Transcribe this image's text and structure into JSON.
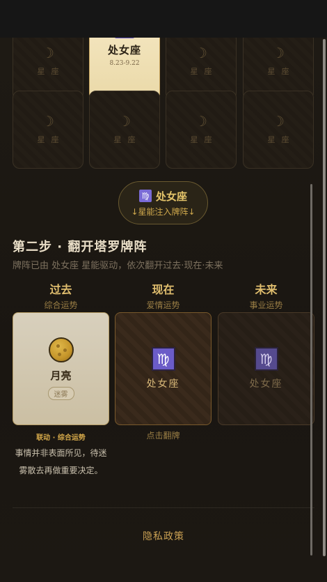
{
  "zodiac_grid": {
    "cells": [
      {
        "symbol": "☽",
        "label": "星座"
      },
      {
        "symbol": "♍",
        "label": "处女座",
        "date": "8.23-9.22",
        "selected": true
      },
      {
        "symbol": "☽",
        "label": "星座"
      },
      {
        "symbol": "☽",
        "label": "星座"
      },
      {
        "symbol": "☽",
        "label": "星座"
      },
      {
        "symbol": "☽",
        "label": "星座"
      },
      {
        "symbol": "☽",
        "label": "星座"
      },
      {
        "symbol": "☽",
        "label": "星座"
      }
    ]
  },
  "energy_pill": {
    "symbol": "♍",
    "name": "处女座",
    "subtitle": "↓星能注入牌阵↓"
  },
  "step": {
    "title": "第二步 · 翻开塔罗牌阵",
    "description": "牌阵已由 处女座 星能驱动，依次翻开过去·现在·未来"
  },
  "spread": {
    "past": {
      "heading": "过去",
      "sub": "综合运势",
      "card_name": "月亮",
      "card_tag": "迷雾",
      "linked": "联动 · 综合运势",
      "explanation": "事情并非表面所见，待迷雾散去再做重要决定。"
    },
    "present": {
      "heading": "现在",
      "sub": "爱情运势",
      "card_symbol": "♍",
      "card_name": "处女座",
      "hint": "点击翻牌"
    },
    "future": {
      "heading": "未来",
      "sub": "事业运势",
      "card_symbol": "♍",
      "card_name": "处女座"
    }
  },
  "footer": {
    "privacy": "隐私政策"
  },
  "colors": {
    "gold": "#e0be6e",
    "accent_purple": "#6b5cc8",
    "background": "#1a1611"
  }
}
